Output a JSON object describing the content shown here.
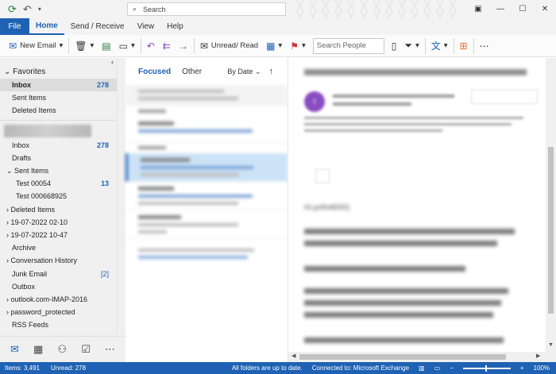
{
  "titlebar": {
    "search_label": "Search",
    "icons": [
      "sync-icon",
      "undo-icon",
      "customize-qat-icon"
    ]
  },
  "menu": {
    "file": "File",
    "tabs": [
      "Home",
      "Send / Receive",
      "View",
      "Help"
    ],
    "active": "Home"
  },
  "ribbon": {
    "new_email": "New Email",
    "unread_read": "Unread/ Read",
    "search_people_placeholder": "Search People"
  },
  "folders": {
    "favorites_header": "Favorites",
    "favorites": [
      {
        "label": "Inbox",
        "count": "278"
      },
      {
        "label": "Sent Items",
        "count": ""
      },
      {
        "label": "Deleted Items",
        "count": ""
      }
    ],
    "items": [
      {
        "label": "Inbox",
        "count": "278"
      },
      {
        "label": "Drafts",
        "count": ""
      },
      {
        "label": "Sent Items",
        "count": ""
      },
      {
        "label": "Test 00054",
        "count": "13"
      },
      {
        "label": "Test 000668925",
        "count": ""
      },
      {
        "label": "Deleted Items",
        "count": ""
      },
      {
        "label": "19-07-2022 02-10",
        "count": ""
      },
      {
        "label": "19-07-2022 10-47",
        "count": ""
      },
      {
        "label": "Archive",
        "count": ""
      },
      {
        "label": "Conversation History",
        "count": ""
      },
      {
        "label": "Junk Email",
        "count": "[2]"
      },
      {
        "label": "Outbox",
        "count": ""
      },
      {
        "label": "outlook.com-IMAP-2016",
        "count": ""
      },
      {
        "label": "password_protected",
        "count": ""
      },
      {
        "label": "RSS Feeds",
        "count": ""
      }
    ]
  },
  "message_list": {
    "focused_tab": "Focused",
    "other_tab": "Other",
    "sort_label": "By Date"
  },
  "reading": {
    "greeting": "Hi pri9vt6003,"
  },
  "status": {
    "items": "Items: 3,491",
    "unread": "Unread: 278",
    "sync": "All folders are up to date.",
    "connection": "Connected to: Microsoft Exchange",
    "zoom": "100%"
  },
  "colors": {
    "accent": "#1f62b4",
    "selected_message": "#cce3f7"
  }
}
